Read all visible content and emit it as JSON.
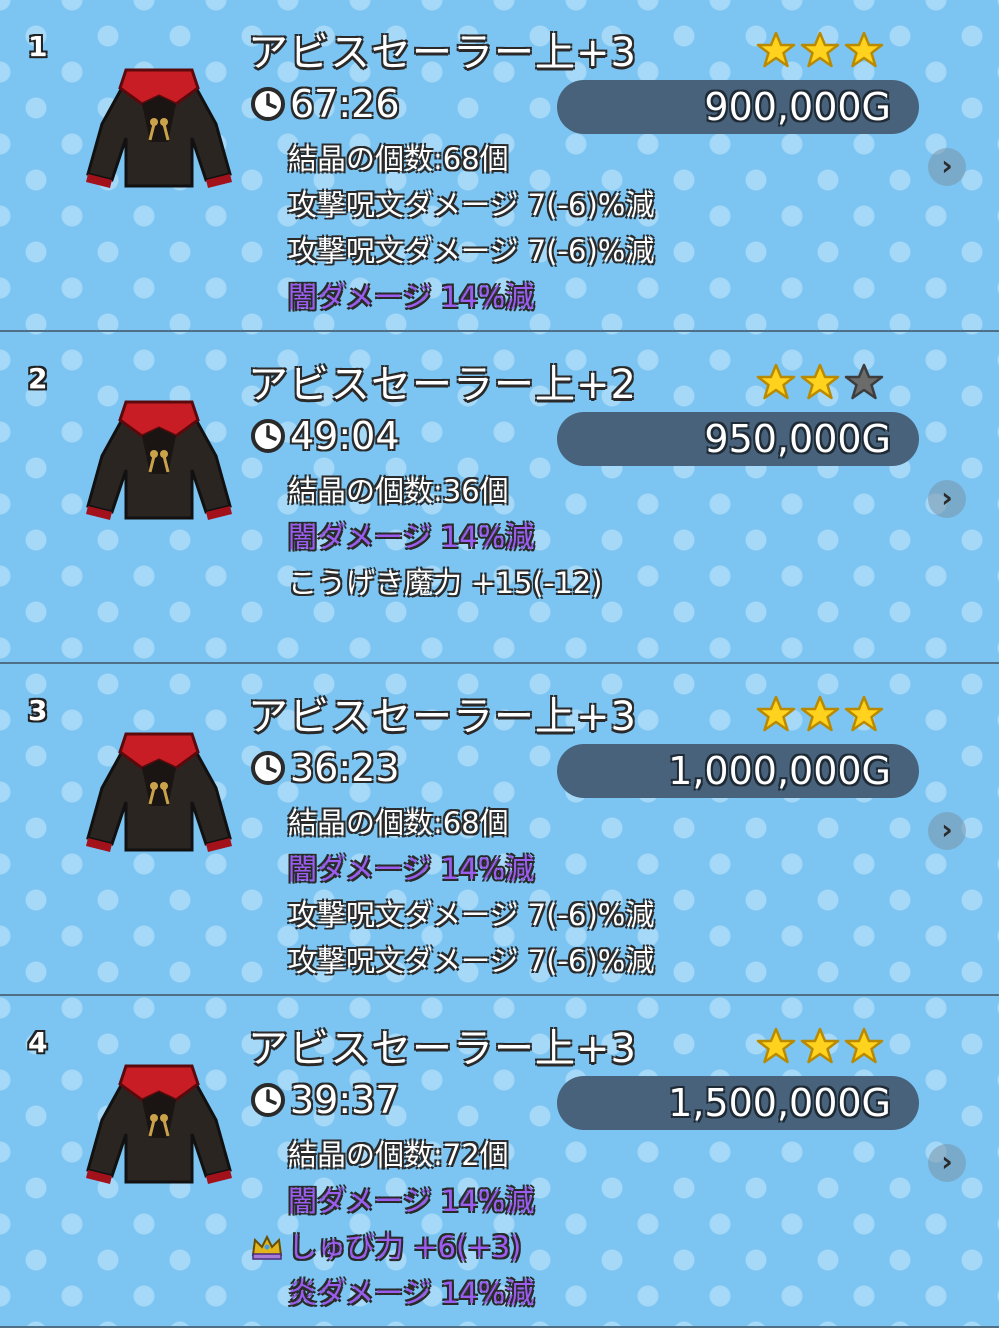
{
  "colors": {
    "background": "#7cc4f2",
    "dark_damage_text": "#9b5cf0",
    "price_pill": "#47627a",
    "star_filled": "#ffd21e",
    "star_empty": "#6b6b6b"
  },
  "listings": [
    {
      "rank": "1",
      "name": "アビスセーラー上+3",
      "stars_filled": 3,
      "stars_total": 3,
      "time_left": "67:26",
      "price": "900,000G",
      "stats": [
        {
          "text": "結晶の個数:68個",
          "style": "normal"
        },
        {
          "text": "攻撃呪文ダメージ 7(-6)%減",
          "style": "normal"
        },
        {
          "text": "攻撃呪文ダメージ 7(-6)%減",
          "style": "normal"
        },
        {
          "text": "闇ダメージ 14%減",
          "style": "dark"
        }
      ]
    },
    {
      "rank": "2",
      "name": "アビスセーラー上+2",
      "stars_filled": 2,
      "stars_total": 3,
      "time_left": "49:04",
      "price": "950,000G",
      "stats": [
        {
          "text": "結晶の個数:36個",
          "style": "normal"
        },
        {
          "text": "闇ダメージ 14%減",
          "style": "dark"
        },
        {
          "text": "こうげき魔力 +15(-12)",
          "style": "normal"
        }
      ]
    },
    {
      "rank": "3",
      "name": "アビスセーラー上+3",
      "stars_filled": 3,
      "stars_total": 3,
      "time_left": "36:23",
      "price": "1,000,000G",
      "stats": [
        {
          "text": "結晶の個数:68個",
          "style": "normal"
        },
        {
          "text": "闇ダメージ 14%減",
          "style": "dark"
        },
        {
          "text": "攻撃呪文ダメージ 7(-6)%減",
          "style": "normal"
        },
        {
          "text": "攻撃呪文ダメージ 7(-6)%減",
          "style": "normal"
        }
      ]
    },
    {
      "rank": "4",
      "name": "アビスセーラー上+3",
      "stars_filled": 3,
      "stars_total": 3,
      "time_left": "39:37",
      "price": "1,500,000G",
      "stats": [
        {
          "text": "結晶の個数:72個",
          "style": "normal"
        },
        {
          "text": "闇ダメージ 14%減",
          "style": "dark"
        },
        {
          "text": "しゅび力 +6(+3)",
          "style": "dark",
          "icon": "crown-icon"
        },
        {
          "text": "炎ダメージ 14%減",
          "style": "dark"
        }
      ]
    }
  ]
}
